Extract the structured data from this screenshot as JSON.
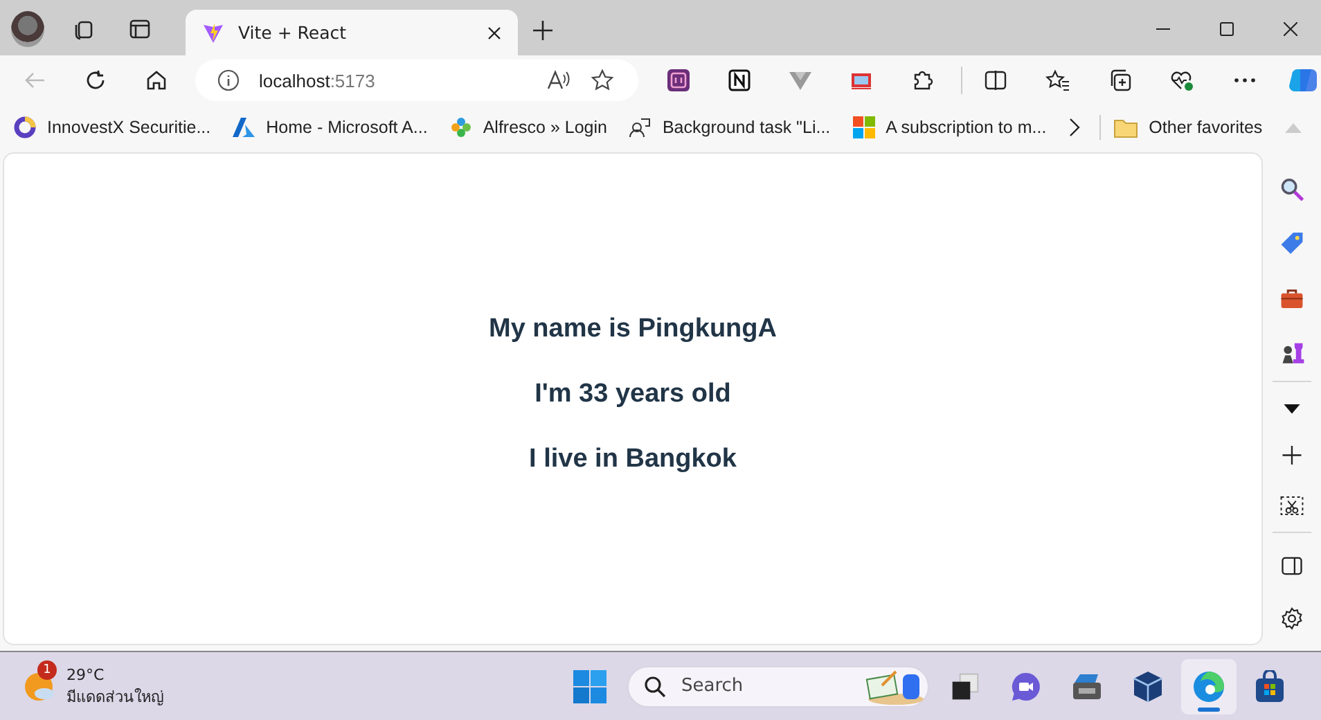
{
  "tab": {
    "title": "Vite + React",
    "selected": true
  },
  "address": {
    "host": "localhost",
    "port": ":5173"
  },
  "bookmarks": [
    {
      "label": "InnovestX Securitie...",
      "kind": "ring"
    },
    {
      "label": "Home - Microsoft A...",
      "kind": "azure"
    },
    {
      "label": "Alfresco » Login",
      "kind": "flower"
    },
    {
      "label": "Background task \"Li...",
      "kind": "task"
    },
    {
      "label": "A subscription to m...",
      "kind": "windows"
    }
  ],
  "other_favorites": "Other favorites",
  "page": {
    "lines": [
      "My name is PingkungA",
      "I'm 33 years old",
      "I live in Bangkok"
    ]
  },
  "taskbar": {
    "weather": {
      "temperature": "29°C",
      "condition": "มีแดดส่วนใหญ่",
      "badge": "1"
    },
    "search": {
      "placeholder": "Search"
    },
    "apps": [
      {
        "kind": "window",
        "selected": false
      },
      {
        "kind": "chat",
        "selected": false
      },
      {
        "kind": "case",
        "selected": false
      },
      {
        "kind": "cube",
        "selected": false
      },
      {
        "kind": "edge",
        "selected": true
      },
      {
        "kind": "store",
        "selected": false
      }
    ]
  }
}
